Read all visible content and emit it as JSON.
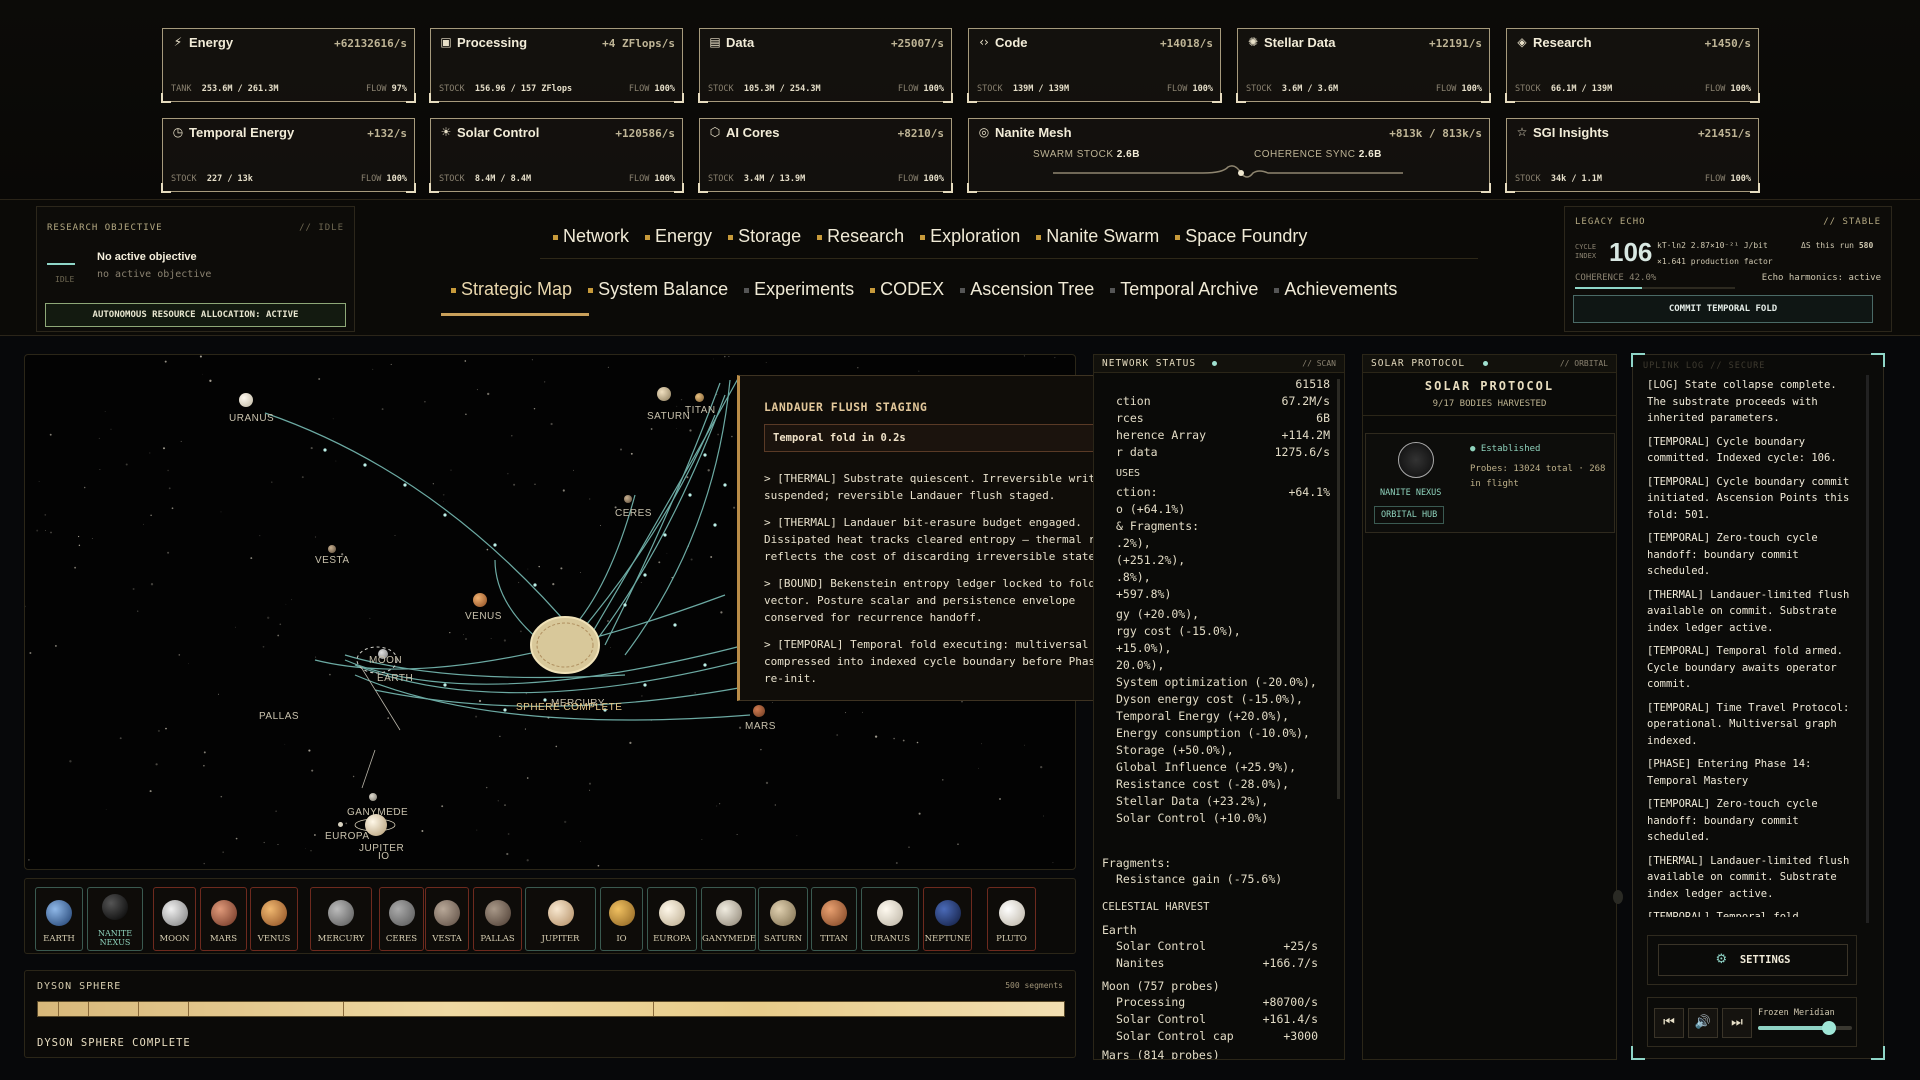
{
  "resources": [
    {
      "name": "Energy",
      "icon": "⚡",
      "icon_name": "lightning-icon",
      "rate": "+62132616/s",
      "stock_label": "TANK",
      "stock": "253.6M / 261.3M",
      "flow": "97%"
    },
    {
      "name": "Processing",
      "icon": "▣",
      "icon_name": "chip-icon",
      "rate": "+4 ZFlops/s",
      "stock_label": "STOCK",
      "stock": "156.96 / 157 ZFlops",
      "flow": "100%"
    },
    {
      "name": "Data",
      "icon": "▤",
      "icon_name": "database-icon",
      "rate": "+25007/s",
      "stock_label": "STOCK",
      "stock": "105.3M / 254.3M",
      "flow": "100%"
    },
    {
      "name": "Code",
      "icon": "‹›",
      "icon_name": "code-icon",
      "rate": "+14018/s",
      "stock_label": "STOCK",
      "stock": "139M / 139M",
      "flow": "100%"
    },
    {
      "name": "Stellar Data",
      "icon": "✺",
      "icon_name": "stellar-icon",
      "rate": "+12191/s",
      "stock_label": "STOCK",
      "stock": "3.6M / 3.6M",
      "flow": "100%"
    },
    {
      "name": "Research",
      "icon": "◈",
      "icon_name": "layers-icon",
      "rate": "+1450/s",
      "stock_label": "STOCK",
      "stock": "66.1M / 139M",
      "flow": "100%"
    },
    {
      "name": "Temporal Energy",
      "icon": "◷",
      "icon_name": "clock-icon",
      "rate": "+132/s",
      "stock_label": "STOCK",
      "stock": "227 / 13k",
      "flow": "100%"
    },
    {
      "name": "Solar Control",
      "icon": "☀",
      "icon_name": "sun-icon",
      "rate": "+120586/s",
      "stock_label": "STOCK",
      "stock": "8.4M / 8.4M",
      "flow": "100%"
    },
    {
      "name": "AI Cores",
      "icon": "⬡",
      "icon_name": "ai-core-icon",
      "rate": "+8210/s",
      "stock_label": "STOCK",
      "stock": "3.4M / 13.9M",
      "flow": "100%"
    },
    {
      "name": "SGI Insights",
      "icon": "☆",
      "icon_name": "star-icon",
      "rate": "+21451/s",
      "stock_label": "STOCK",
      "stock": "34k / 1.1M",
      "flow": "100%"
    }
  ],
  "nanite_mesh": {
    "name": "Nanite Mesh",
    "icon": "◎",
    "rate": "+813k / 813k/s",
    "swarm_label": "SWARM STOCK",
    "swarm_value": "2.6B",
    "coherence_label": "COHERENCE SYNC",
    "coherence_value": "2.6B"
  },
  "research_objective": {
    "title": "RESEARCH OBJECTIVE",
    "status": "// IDLE",
    "main": "No active objective",
    "sub": "no active objective",
    "idle": "IDLE",
    "button": "AUTONOMOUS RESOURCE ALLOCATION: ACTIVE"
  },
  "nav_row1": [
    "Network",
    "Energy",
    "Storage",
    "Research",
    "Exploration",
    "Nanite Swarm",
    "Space Foundry"
  ],
  "nav_row2": [
    "Strategic Map",
    "System Balance",
    "Experiments",
    "CODEX",
    "Ascension Tree",
    "Temporal Archive",
    "Achievements"
  ],
  "legacy": {
    "title": "LEGACY ECHO",
    "status": "// STABLE",
    "cycle_label": "CYCLE INDEX",
    "cycle": "106",
    "kt": "kT·ln2 2.87×10⁻²¹ J/bit",
    "run": "ΔS this run",
    "run_val": "580",
    "factor": "×1.641 production factor",
    "coherence": "COHERENCE 42.0%",
    "harmonics": "Echo harmonics: active",
    "button": "COMMIT TEMPORAL FOLD"
  },
  "map_labels": [
    "URANUS",
    "SATURN",
    "TITAN",
    "CERES",
    "VESTA",
    "VENUS",
    "MOON",
    "EARTH",
    "MERCURY",
    "SPHERE COMPLETE",
    "MARS",
    "PALLAS",
    "GANYMEDE",
    "EUROPA",
    "JUPITER",
    "IO"
  ],
  "tooltip": {
    "title": "LANDAUER FLUSH STAGING",
    "fold": "Temporal fold in 0.2s",
    "lines": [
      "> [THERMAL] Substrate quiescent. Irreversible writes suspended; reversible Landauer flush staged.",
      "> [THERMAL] Landauer bit-erasure budget engaged. Dissipated heat tracks cleared entropy — thermal readout reflects the cost of discarding irreversible state.",
      "> [BOUND] Bekenstein entropy ledger locked to fold vector. Posture scalar and persistence envelope conserved for recurrence handoff.",
      "> [TEMPORAL] Temporal fold executing: multiversal branch compressed into indexed cycle boundary before Phase-zero re-init."
    ]
  },
  "bodies": [
    "EARTH",
    "NANITE NEXUS",
    "MOON",
    "MARS",
    "VENUS",
    "MERCURY",
    "CERES",
    "VESTA",
    "PALLAS",
    "JUPITER",
    "IO",
    "EUROPA",
    "GANYMEDE",
    "SATURN",
    "TITAN",
    "URANUS",
    "NEPTUNE",
    "PLUTO"
  ],
  "dyson": {
    "title": "DYSON SPHERE",
    "segments": "500 segments",
    "status": "DYSON SPHERE COMPLETE"
  },
  "network": {
    "title": "NETWORK STATUS",
    "status": "// SCAN",
    "rows": [
      [
        "",
        "61518"
      ],
      [
        "ction",
        "67.2M/s"
      ],
      [
        "rces",
        "6B"
      ],
      [
        "herence Array",
        "+114.2M"
      ],
      [
        "r data",
        "1275.6/s"
      ],
      [
        "USES",
        ""
      ],
      [
        "ction:",
        "+64.1%"
      ],
      [
        "o (+64.1%)",
        ""
      ],
      [
        "& Fragments:",
        ""
      ],
      [
        ".2%),",
        ""
      ],
      [
        "(+251.2%),",
        ""
      ],
      [
        ".8%),",
        ""
      ],
      [
        "+597.8%)",
        ""
      ],
      [
        "gy (+20.0%),",
        ""
      ],
      [
        "rgy cost (-15.0%),",
        ""
      ],
      [
        "+15.0%),",
        ""
      ],
      [
        "20.0%),",
        ""
      ],
      [
        "System optimization (-20.0%),",
        ""
      ],
      [
        "Dyson energy cost (-15.0%),",
        ""
      ],
      [
        "Temporal Energy (+20.0%),",
        ""
      ],
      [
        "Energy consumption (-10.0%),",
        ""
      ],
      [
        "Storage (+50.0%),",
        ""
      ],
      [
        "Global Influence (+25.9%),",
        ""
      ],
      [
        "Resistance cost (-28.0%),",
        ""
      ],
      [
        "Stellar Data (+23.2%),",
        ""
      ],
      [
        "Solar Control (+10.0%)",
        ""
      ]
    ],
    "fragments": "Fragments:",
    "resistance": "Resistance gain (-75.6%)",
    "harvest_title": "CELESTIAL HARVEST",
    "earth": "Earth",
    "earth_rows": [
      [
        "Solar Control",
        "+25/s"
      ],
      [
        "Nanites",
        "+166.7/s"
      ]
    ],
    "moon": "Moon (757 probes)",
    "moon_rows": [
      [
        "Processing",
        "+80700/s"
      ],
      [
        "Solar Control",
        "+161.4/s"
      ],
      [
        "Solar Control cap",
        "+3000"
      ]
    ],
    "mars": "Mars (814 probes)"
  },
  "solar": {
    "title": "SOLAR PROTOCOL",
    "status": "// ORBITAL",
    "heading": "SOLAR PROTOCOL",
    "sub": "9/17 BODIES HARVESTED",
    "node": "NANITE NEXUS",
    "established": "Established",
    "probes": "Probes: 13024 total · 268 in flight",
    "hub": "ORBITAL HUB"
  },
  "log": {
    "title": "UPLINK LOG // SECURE",
    "entries": [
      "[LOG] State collapse complete. The substrate proceeds with inherited parameters.",
      "[TEMPORAL] Cycle boundary committed. Indexed cycle: 106.",
      "[TEMPORAL] Cycle boundary commit initiated. Ascension Points this fold: 501.",
      "[TEMPORAL] Zero-touch cycle handoff: boundary commit scheduled.",
      "[THERMAL] Landauer-limited flush available on commit. Substrate index ledger active.",
      "[TEMPORAL] Temporal fold armed. Cycle boundary awaits operator commit.",
      "[TEMPORAL] Time Travel Protocol: operational. Multiversal graph indexed.",
      "[PHASE] Entering Phase 14: Temporal Mastery",
      "[TEMPORAL] Zero-touch cycle handoff: boundary commit scheduled.",
      "[THERMAL] Landauer-limited flush available on commit. Substrate index ledger active.",
      "[TEMPORAL] Temporal fold"
    ],
    "settings": "SETTINGS",
    "track": "Frozen Meridian",
    "volume": 0.75
  }
}
